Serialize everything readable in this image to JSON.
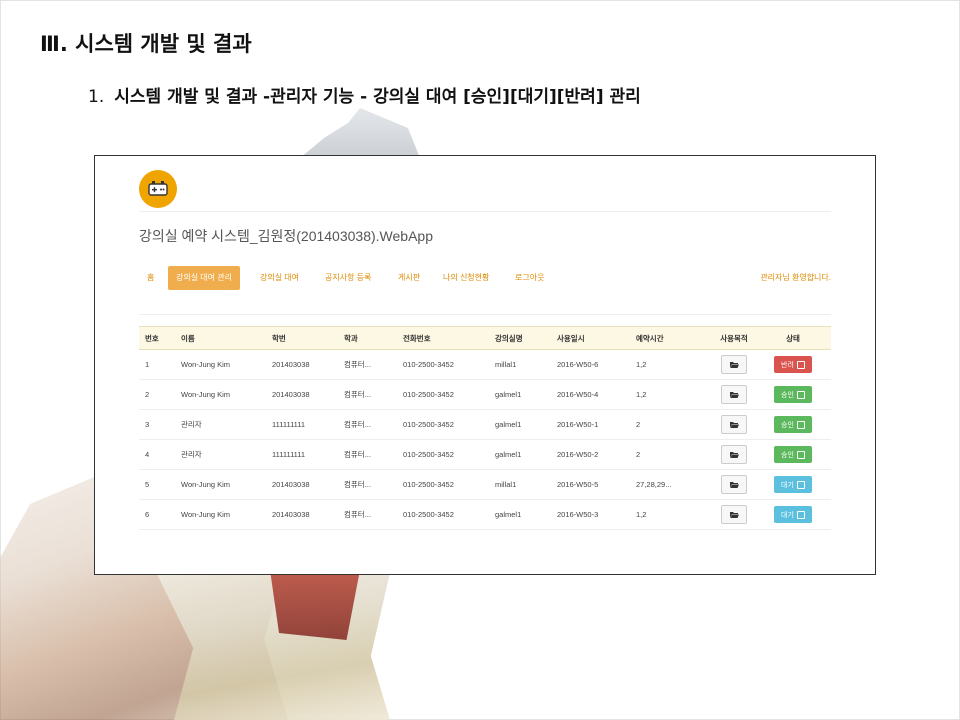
{
  "slide": {
    "title": "Ⅲ. 시스템 개발 및 결과",
    "subtitle_number": "1.",
    "subtitle_text": "시스템 개발 및 결과 -관리자 기능 - 강의실 대여 [승인][대기][반려] 관리"
  },
  "app": {
    "logo_icon": "gamepad-icon",
    "title": "강의실 예약 시스템_김원정(201403038).WebApp",
    "nav": {
      "items": [
        "홈",
        "강의실 대여 관리",
        "강의실 대여",
        "공지사항 등록",
        "게시판",
        "나의 신청현황",
        "로그아웃"
      ],
      "active_index": 1,
      "welcome": "관리자님 환영합니다."
    },
    "colors": {
      "accent": "#f0ad4e",
      "nav_text": "#e08a00",
      "status_반려": "#d9534f",
      "status_승인": "#5cb85c",
      "status_대기": "#5bc0de"
    },
    "table": {
      "headers": [
        "번호",
        "이름",
        "학번",
        "학과",
        "전화번호",
        "강의실명",
        "사용일시",
        "예약시간",
        "사용목적",
        "상태"
      ],
      "rows": [
        {
          "no": "1",
          "name": "Won-Jung Kim",
          "student_id": "201403038",
          "dept": "컴퓨터...",
          "phone": "010-2500-3452",
          "room": "millal1",
          "date": "2016-W50-6",
          "time": "1,2",
          "purpose_icon": "folder-open-icon",
          "status": "반려"
        },
        {
          "no": "2",
          "name": "Won-Jung Kim",
          "student_id": "201403038",
          "dept": "컴퓨터...",
          "phone": "010-2500-3452",
          "room": "galmel1",
          "date": "2016-W50-4",
          "time": "1,2",
          "purpose_icon": "folder-open-icon",
          "status": "승인"
        },
        {
          "no": "3",
          "name": "관리자",
          "student_id": "111111111",
          "dept": "컴퓨터...",
          "phone": "010-2500-3452",
          "room": "galmel1",
          "date": "2016-W50-1",
          "time": "2",
          "purpose_icon": "folder-open-icon",
          "status": "승인"
        },
        {
          "no": "4",
          "name": "관리자",
          "student_id": "111111111",
          "dept": "컴퓨터...",
          "phone": "010-2500-3452",
          "room": "galmel1",
          "date": "2016-W50-2",
          "time": "2",
          "purpose_icon": "folder-open-icon",
          "status": "승인"
        },
        {
          "no": "5",
          "name": "Won-Jung Kim",
          "student_id": "201403038",
          "dept": "컴퓨터...",
          "phone": "010-2500-3452",
          "room": "millal1",
          "date": "2016-W50-5",
          "time": "27,28,29...",
          "purpose_icon": "folder-open-icon",
          "status": "대기"
        },
        {
          "no": "6",
          "name": "Won-Jung Kim",
          "student_id": "201403038",
          "dept": "컴퓨터...",
          "phone": "010-2500-3452",
          "room": "galmel1",
          "date": "2016-W50-3",
          "time": "1,2",
          "purpose_icon": "folder-open-icon",
          "status": "대기"
        }
      ]
    }
  }
}
